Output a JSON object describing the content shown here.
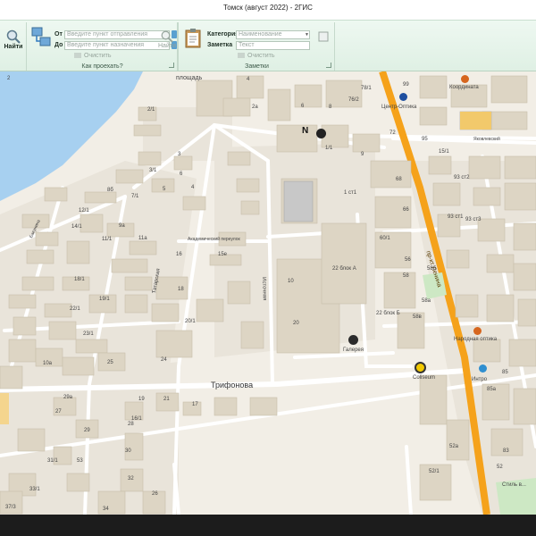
{
  "window": {
    "title": "Томск (август 2022) - 2ГИС"
  },
  "ribbon": {
    "search": {
      "label": "Найти",
      "icon": "magnifier-icon"
    },
    "route": {
      "group_label": "Как проехать?",
      "from_label": "От",
      "to_label": "До",
      "from_placeholder": "Введите пункт отправления",
      "to_placeholder": "Введите пункт назначения",
      "clear_label": "Очистить",
      "find_label": "Найти"
    },
    "notes": {
      "group_label": "Заметки",
      "category_label": "Категория",
      "category_placeholder": "Наименование",
      "note_label": "Заметка",
      "note_placeholder": "Текст",
      "clear_label": "Очистить"
    }
  },
  "map": {
    "streets": {
      "trifonova": "Трифонова",
      "square": "площадь",
      "lenina": "пр-кт Ленина",
      "tatarskaya": "Татарская",
      "istochnaya": "Источная",
      "akademicheskiy": "Академический переулок",
      "bakunina": "Бакунина",
      "yakovlevskiy": "Яковлевский"
    },
    "places": {
      "centr_optika": "Центр-Оптика",
      "koordinata": "Координата",
      "narodnaya_optika": "Народная оптика",
      "coliseum": "Coliseum",
      "galereya": "Галерея",
      "intro": "Интро",
      "stil": "Стиль в..."
    },
    "house_numbers": [
      "2",
      "4",
      "99",
      "78/1",
      "76/2",
      "8",
      "2а",
      "6",
      "72",
      "95",
      "2/1",
      "15/1",
      "9",
      "3",
      "6",
      "93 ст2",
      "1/1",
      "1 ст1",
      "68",
      "3/1",
      "5",
      "4",
      "93 ст1",
      "93 ст3",
      "8б",
      "7/1",
      "12/1",
      "66",
      "14/1",
      "9а",
      "11/1",
      "11а",
      "60/1",
      "16",
      "15е",
      "56",
      "18",
      "18/1",
      "19/1",
      "20/1",
      "22/1",
      "23/1",
      "22 блок А",
      "22 блок Б",
      "58",
      "58а",
      "58б",
      "58в",
      "24",
      "29а",
      "85",
      "85а",
      "25",
      "10",
      "10а",
      "20",
      "17",
      "16/1",
      "52",
      "52а",
      "52/1",
      "83",
      "53",
      "31/1",
      "33/1",
      "37/3",
      "34",
      "32",
      "30",
      "28",
      "29",
      "27",
      "26",
      "19",
      "21"
    ],
    "north_marker": "N"
  },
  "colors": {
    "main_road": "#f5a21b",
    "water": "#a7d0f0",
    "building": "#ddd5c4",
    "building_roof": "#ece7dd",
    "ribbon_bg": "#e6f4ea"
  }
}
